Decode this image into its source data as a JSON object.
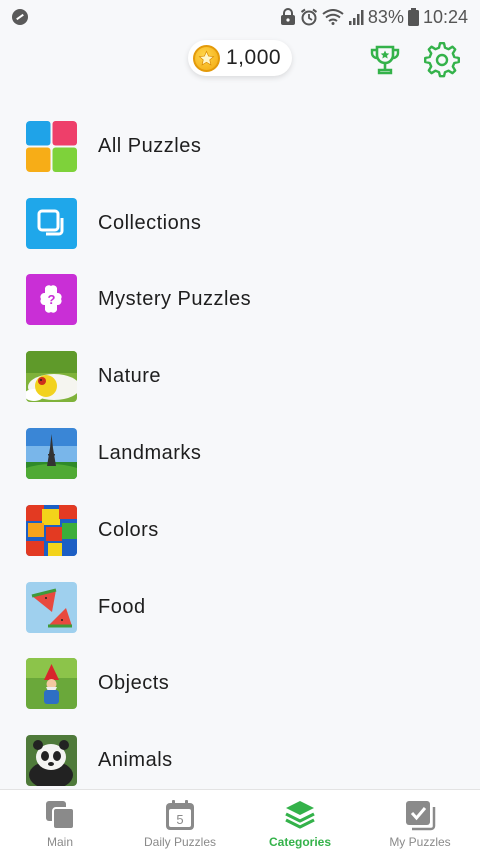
{
  "status_bar": {
    "battery_percent": "83%",
    "time": "10:24",
    "icons": [
      "app-notification-icon",
      "vpn-lock-icon",
      "alarm-icon",
      "wifi-icon",
      "signal-icon",
      "battery-icon"
    ]
  },
  "header": {
    "coins": "1,000",
    "coin_icon": "star-coin-icon",
    "trophy_icon": "trophy-icon",
    "settings_icon": "gear-icon",
    "accent_color": "#34b24a"
  },
  "categories": [
    {
      "label": "All Puzzles",
      "icon": "all-puzzles-icon"
    },
    {
      "label": "Collections",
      "icon": "collections-icon"
    },
    {
      "label": "Mystery Puzzles",
      "icon": "mystery-puzzle-icon"
    },
    {
      "label": "Nature",
      "icon": "nature-thumbnail"
    },
    {
      "label": "Landmarks",
      "icon": "landmarks-thumbnail"
    },
    {
      "label": "Colors",
      "icon": "colors-thumbnail"
    },
    {
      "label": "Food",
      "icon": "food-thumbnail"
    },
    {
      "label": "Objects",
      "icon": "objects-thumbnail"
    },
    {
      "label": "Animals",
      "icon": "animals-thumbnail"
    }
  ],
  "bottom_nav": {
    "items": [
      {
        "label": "Main",
        "icon": "main-icon"
      },
      {
        "label": "Daily Puzzles",
        "icon": "calendar-icon",
        "badge": "5"
      },
      {
        "label": "Categories",
        "icon": "layers-icon"
      },
      {
        "label": "My Puzzles",
        "icon": "my-puzzles-icon"
      }
    ],
    "active": "Categories",
    "inactive_color": "#8a8a8a",
    "active_color": "#34b24a"
  }
}
